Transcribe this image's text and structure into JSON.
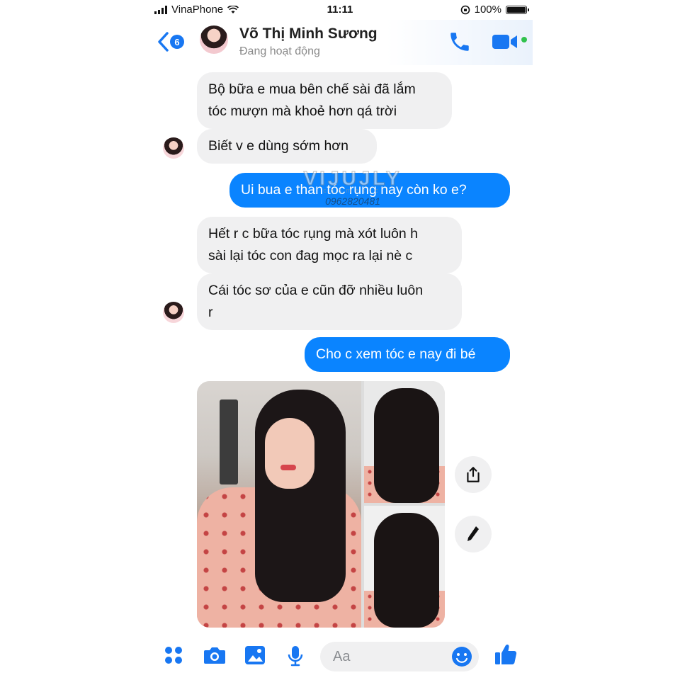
{
  "status_bar": {
    "carrier": "VinaPhone",
    "time": "11:11",
    "battery": "100%"
  },
  "header": {
    "unread_count": "6",
    "name": "Võ Thị Minh Sương",
    "status": "Đang hoạt động"
  },
  "messages": [
    {
      "from": "them",
      "text_lines": [
        "Bộ bữa e mua bên chế sài đã lắm",
        "tóc mượn mà khoẻ hơn qá trời"
      ]
    },
    {
      "from": "them",
      "text_lines": [
        "Biết v e dùng sớm hơn"
      ]
    },
    {
      "from": "me",
      "text_lines": [
        "Ui bua e than tóc rụng nay còn ko e?"
      ]
    },
    {
      "from": "them",
      "text_lines": [
        "Hết r c bữa tóc rụng mà xót luôn h",
        "sài lại tóc con đag mọc ra lại nè c"
      ]
    },
    {
      "from": "them",
      "text_lines": [
        "Cái tóc sơ của e cũn đỡ nhiều luôn",
        "r"
      ]
    },
    {
      "from": "me",
      "text_lines": [
        "Cho c xem tóc e nay đi bé"
      ]
    }
  ],
  "watermark": {
    "brand": "VIJUJLY",
    "sub": "cosmetic",
    "phone": "0962820481"
  },
  "composer": {
    "placeholder": "Aa"
  },
  "colors": {
    "accent": "#0a84ff",
    "icon_blue": "#1877f2",
    "incoming_bubble": "#f0f0f1",
    "online": "#31c24d"
  },
  "icons": [
    "chevron-left-icon",
    "phone-icon",
    "video-camera-icon",
    "share-icon",
    "edit-pencil-icon",
    "apps-grid-icon",
    "camera-icon",
    "gallery-icon",
    "microphone-icon",
    "emoji-icon",
    "thumbs-up-icon"
  ]
}
